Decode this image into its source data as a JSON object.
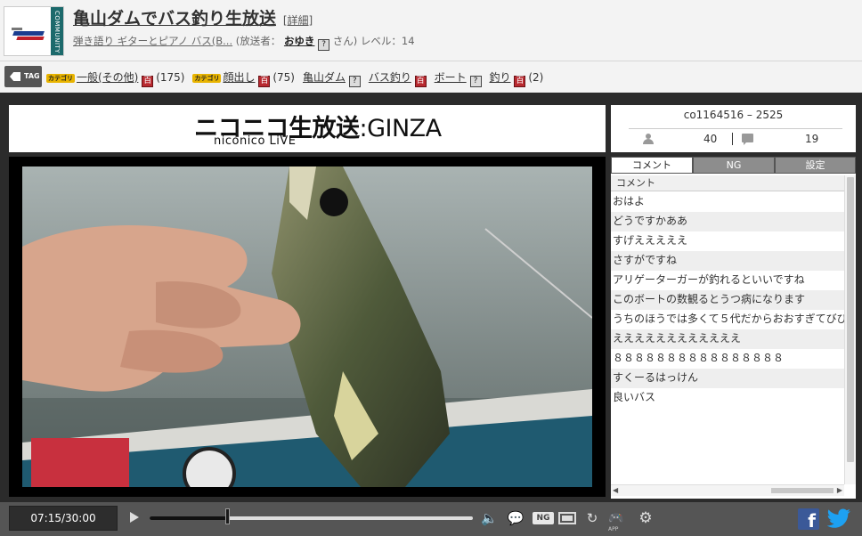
{
  "header": {
    "community_badge": "COMMUNITY",
    "title": "亀山ダムでバス釣り生放送",
    "detail_link": "[詳細]",
    "community_name": "弾き語り ギターとピアノ バス(B...",
    "broadcaster_label": "(放送者：",
    "broadcaster_name": "おゆき",
    "broadcaster_suffix": "さん)",
    "level": "レベル：14"
  },
  "tag_bar": {
    "label": "TAG",
    "tags": [
      {
        "name": "一般(その他)",
        "category": "カテゴリ",
        "lock": "百",
        "count": "(175)"
      },
      {
        "name": "顔出し",
        "category": "カテゴリ",
        "lock": "百",
        "count": "(75)"
      },
      {
        "name": "亀山ダム",
        "category": "",
        "lock": "?",
        "count": ""
      },
      {
        "name": "バス釣り",
        "category": "",
        "lock": "百",
        "count": ""
      },
      {
        "name": "ボート",
        "category": "",
        "lock": "?",
        "count": ""
      },
      {
        "name": "釣り",
        "category": "",
        "lock": "百",
        "count": "(2)"
      }
    ]
  },
  "player": {
    "brand_main": "ニコニコ生放送",
    "brand_main_suffix": ":GINZA",
    "brand_sub": "niconico LiVE"
  },
  "stats": {
    "community_id": "co1164516 – 2525",
    "viewers": "40",
    "comments": "19"
  },
  "comment_panel": {
    "tabs": [
      "コメント",
      "NG",
      "設定"
    ],
    "active_tab": "コメント",
    "column_header": "コメント",
    "comments": [
      "おはよ",
      "どうですかああ",
      "すげえええええ",
      "さすがですね",
      "アリゲーターガーが釣れるといいですね",
      "このボートの数観るとうつ病になります",
      "うちのほうでは多くて５代だからおおすぎてびびる",
      "ええええええええええええ",
      "８８８８８８８８８８８８８８８８",
      "すくーるはっけん",
      "良いバス"
    ]
  },
  "controls": {
    "time": "07:15/30:00",
    "progress": 0.242,
    "ng_label": "NG",
    "app_label": "APP"
  },
  "colors": {
    "header_bg": "#f3f3f3",
    "player_bg": "#2b2b2b",
    "control_bg": "#555555",
    "facebook": "#3b5998",
    "twitter": "#1da1f2",
    "tag_lock_red": "#b8292f"
  }
}
